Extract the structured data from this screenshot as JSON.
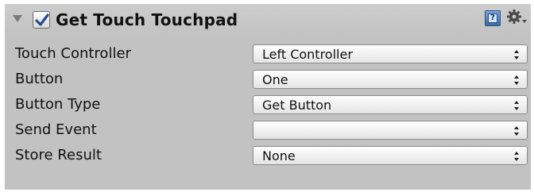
{
  "component": {
    "title": "Get Touch Touchpad",
    "enabled": true,
    "icons": {
      "foldout": "foldout-expanded-icon",
      "help": "help-book-icon",
      "settings": "gear-icon"
    }
  },
  "fields": [
    {
      "label": "Touch Controller",
      "value": "Left Controller"
    },
    {
      "label": "Button",
      "value": "One"
    },
    {
      "label": "Button Type",
      "value": "Get Button"
    },
    {
      "label": "Send Event",
      "value": ""
    },
    {
      "label": "Store Result",
      "value": "None"
    }
  ],
  "colors": {
    "panel_bg": "#c2c2c2",
    "checkmark": "#2a4a8a"
  }
}
